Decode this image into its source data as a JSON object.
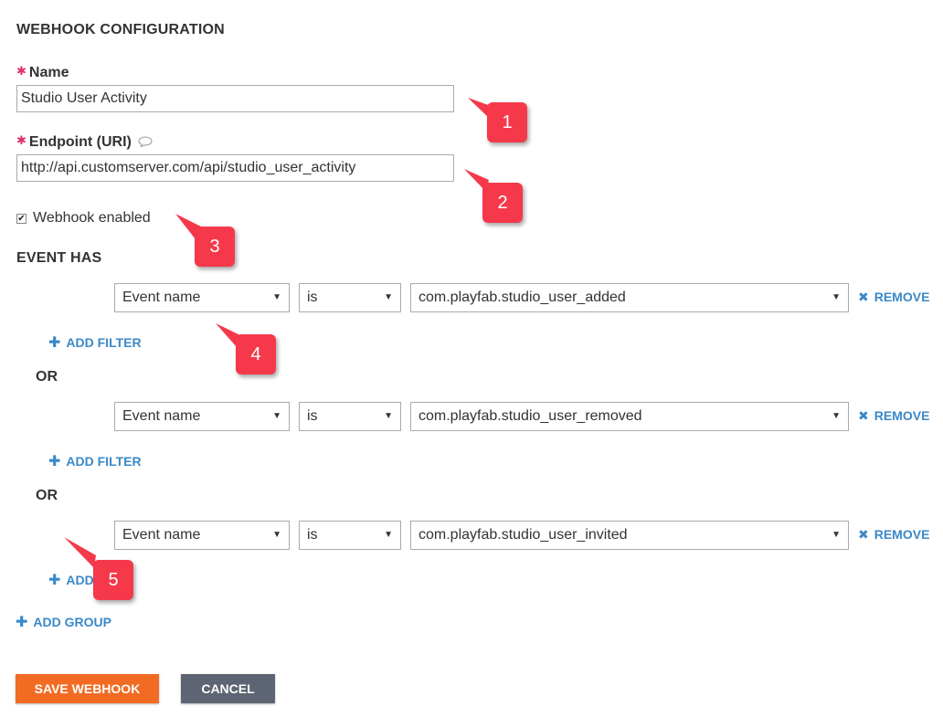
{
  "header": {
    "title": "WEBHOOK CONFIGURATION"
  },
  "name_field": {
    "label": "Name",
    "value": "Studio User Activity"
  },
  "endpoint_field": {
    "label": "Endpoint (URI)",
    "value": "http://api.customserver.com/api/studio_user_activity"
  },
  "enabled_checkbox": {
    "label": "Webhook enabled",
    "checked": true
  },
  "event_has_label": "EVENT HAS",
  "or_label": "OR",
  "groups": [
    {
      "field": "Event name",
      "operator": "is",
      "value": "com.playfab.studio_user_added",
      "remove": "REMOVE",
      "add_filter": "ADD FILTER"
    },
    {
      "field": "Event name",
      "operator": "is",
      "value": "com.playfab.studio_user_removed",
      "remove": "REMOVE",
      "add_filter": "ADD FILTER"
    },
    {
      "field": "Event name",
      "operator": "is",
      "value": "com.playfab.studio_user_invited",
      "remove": "REMOVE",
      "add_filter": "ADD"
    }
  ],
  "add_group": "ADD GROUP",
  "buttons": {
    "save": "SAVE WEBHOOK",
    "cancel": "CANCEL"
  },
  "callouts": [
    "1",
    "2",
    "3",
    "4",
    "5"
  ],
  "colors": {
    "required": "#e0306c",
    "link": "#3a89c9",
    "save": "#f26b22",
    "cancel": "#5d6473",
    "callout": "#f5394b"
  },
  "icons": {
    "required": "asterisk-icon",
    "info": "speech-bubble-icon",
    "caret": "caret-down-icon",
    "plus": "plus-icon",
    "remove": "x-icon",
    "checkbox": "checkmark-icon"
  }
}
